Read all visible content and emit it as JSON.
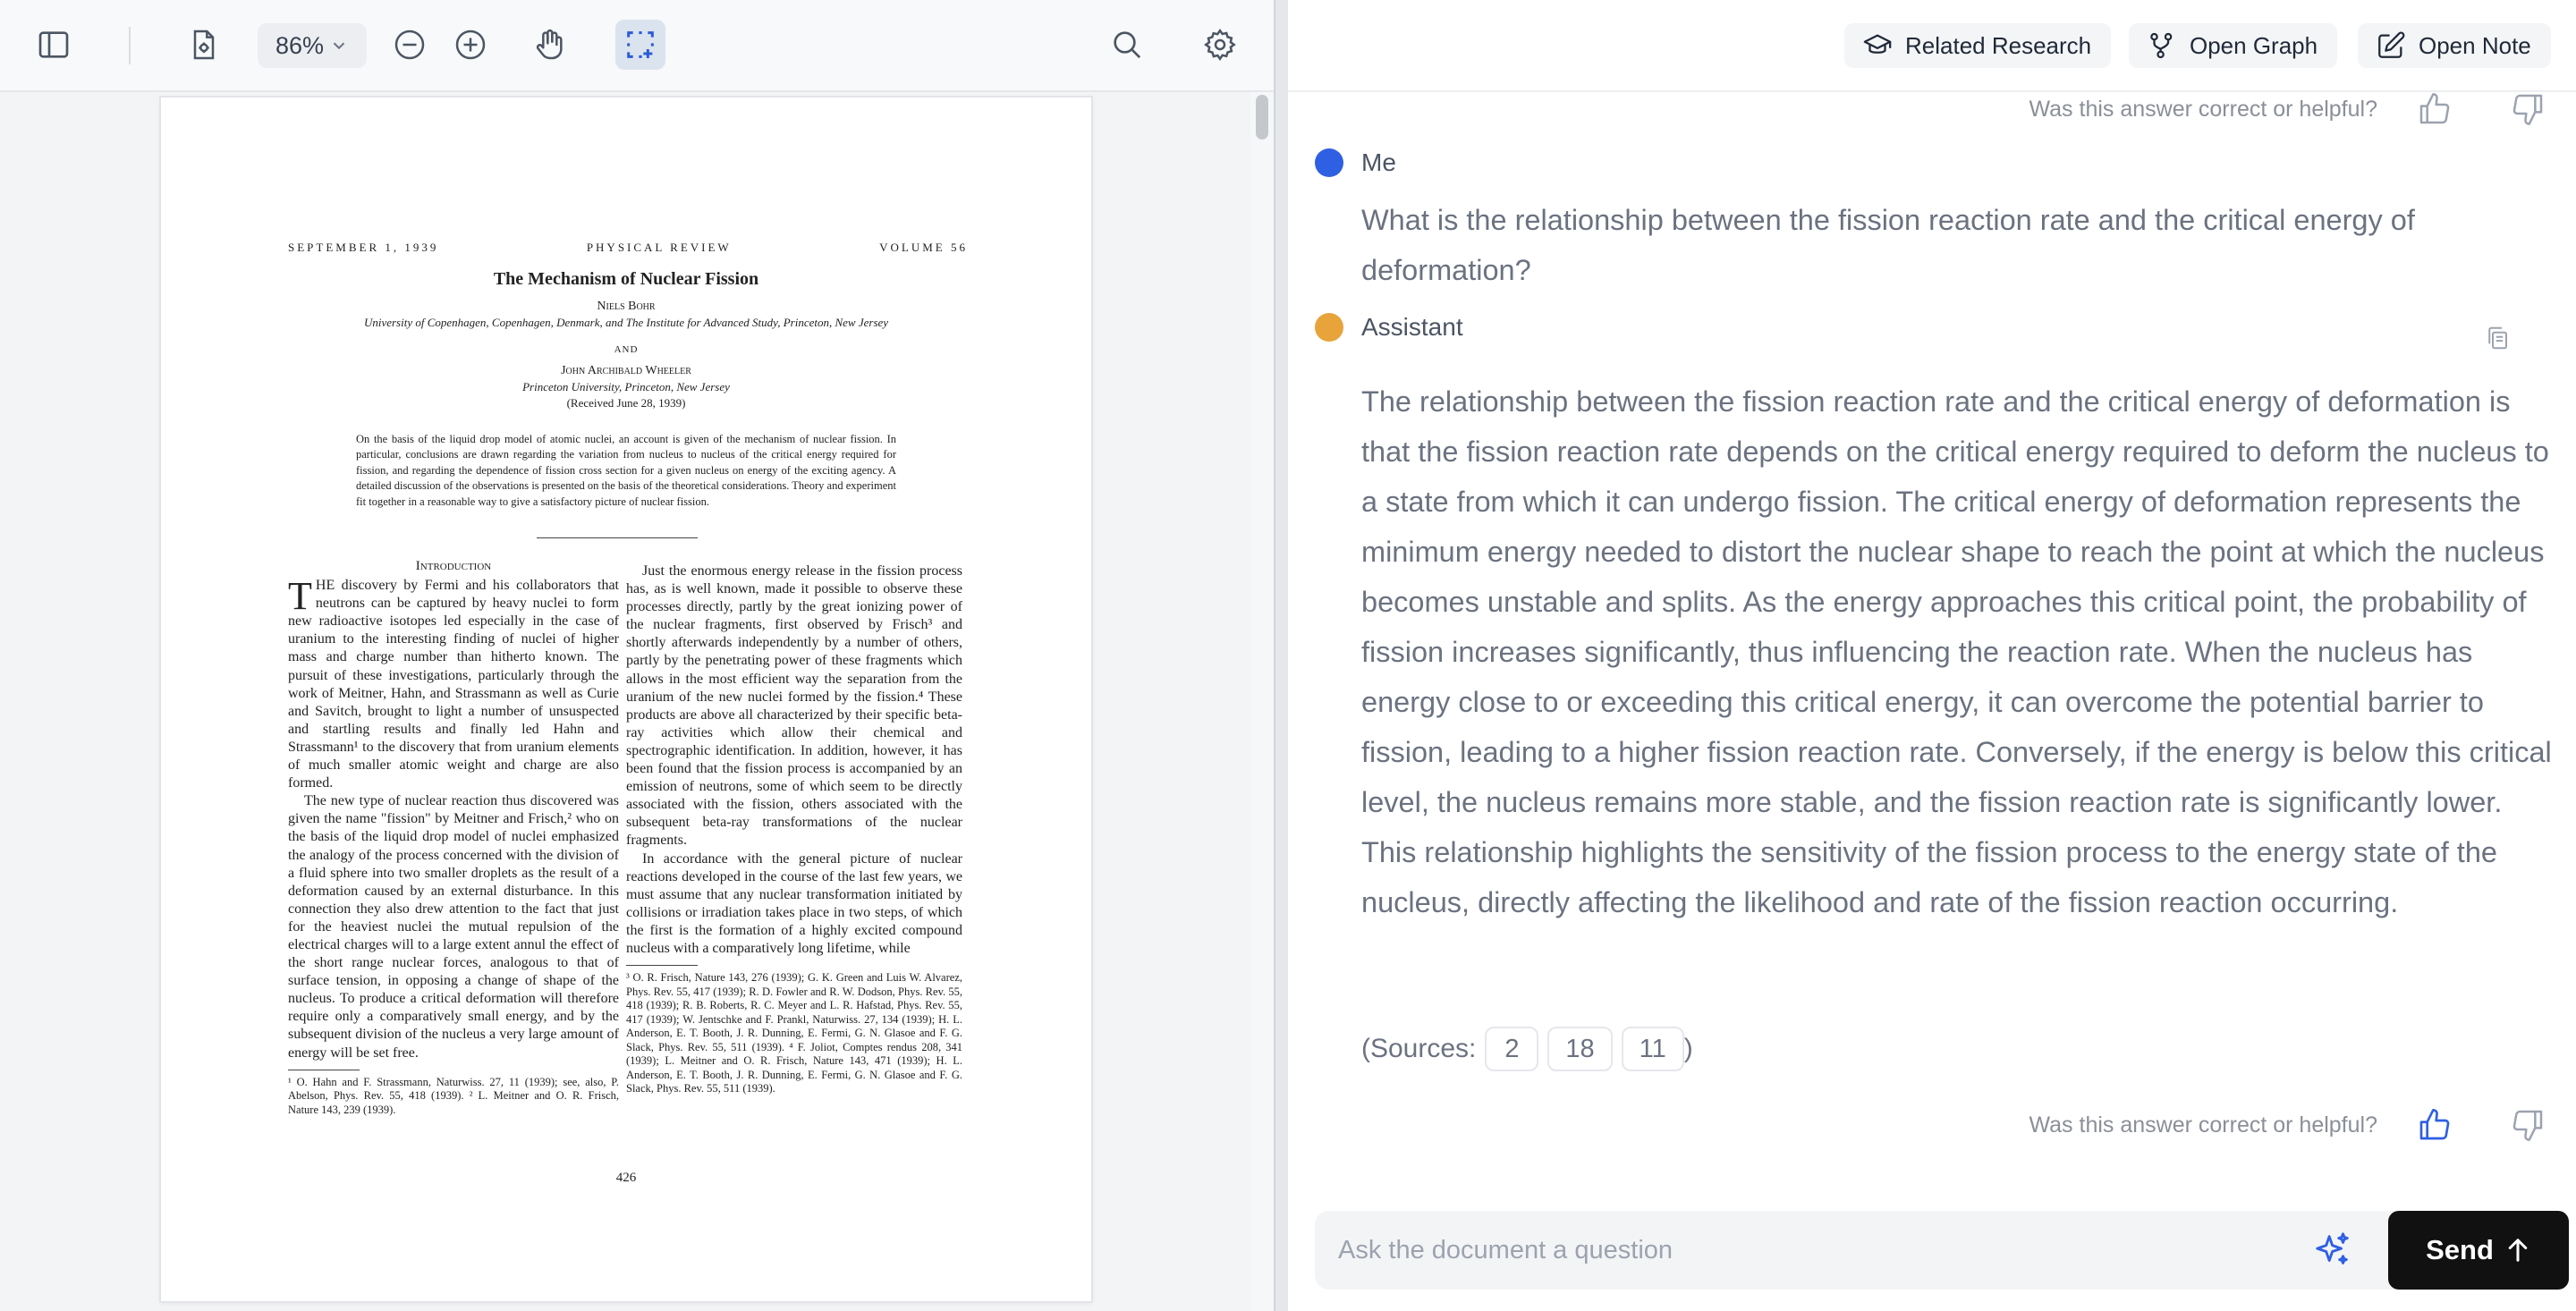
{
  "viewer": {
    "zoom": "86%",
    "pdf": {
      "running_head": {
        "date": "SEPTEMBER 1, 1939",
        "journal": "PHYSICAL REVIEW",
        "volume": "VOLUME 56"
      },
      "title": "The Mechanism of Nuclear Fission",
      "author1": "Niels Bohr",
      "affil1": "University of Copenhagen, Copenhagen, Denmark, and The Institute for Advanced Study, Princeton, New Jersey",
      "and": "AND",
      "author2": "John Archibald Wheeler",
      "affil2": "Princeton University, Princeton, New Jersey",
      "received": "(Received June 28, 1939)",
      "abstract": "On the basis of the liquid drop model of atomic nuclei, an account is given of the mechanism of nuclear fission. In particular, conclusions are drawn regarding the variation from nucleus to nucleus of the critical energy required for fission, and regarding the dependence of fission cross section for a given nucleus on energy of the exciting agency. A detailed discussion of the observations is presented on the basis of the theoretical considerations. Theory and experiment fit together in a reasonable way to give a satisfactory picture of nuclear fission.",
      "intro_heading": "Introduction",
      "dropcap": "T",
      "col1_p1": "HE discovery by Fermi and his collaborators that neutrons can be captured by heavy nuclei to form new radioactive isotopes led especially in the case of uranium to the interesting finding of nuclei of higher mass and charge number than hitherto known. The pursuit of these investigations, particularly through the work of Meitner, Hahn, and Strassmann as well as Curie and Savitch, brought to light a number of unsuspected and startling results and finally led Hahn and Strassmann¹ to the discovery that from uranium elements of much smaller atomic weight and charge are also formed.",
      "col1_p2": "The new type of nuclear reaction thus discovered was given the name \"fission\" by Meitner and Frisch,² who on the basis of the liquid drop model of nuclei emphasized the analogy of the process concerned with the division of a fluid sphere into two smaller droplets as the result of a deformation caused by an external disturbance. In this connection they also drew attention to the fact that just for the heaviest nuclei the mutual repulsion of the electrical charges will to a large extent annul the effect of the short range nuclear forces, analogous to that of surface tension, in opposing a change of shape of the nucleus. To produce a critical deformation will therefore require only a comparatively small energy, and by the subsequent division of the nucleus a very large amount of energy will be set free.",
      "col1_fn": "¹ O. Hahn and F. Strassmann, Naturwiss. 27, 11 (1939); see, also, P. Abelson, Phys. Rev. 55, 418 (1939). ² L. Meitner and O. R. Frisch, Nature 143, 239 (1939).",
      "col2_p1": "Just the enormous energy release in the fission process has, as is well known, made it possible to observe these processes directly, partly by the great ionizing power of the nuclear fragments, first observed by Frisch³ and shortly afterwards independently by a number of others, partly by the penetrating power of these fragments which allows in the most efficient way the separation from the uranium of the new nuclei formed by the fission.⁴ These products are above all characterized by their specific beta-ray activities which allow their chemical and spectrographic identification. In addition, however, it has been found that the fission process is accompanied by an emission of neutrons, some of which seem to be directly associated with the fission, others associated with the subsequent beta-ray transformations of the nuclear fragments.",
      "col2_p2": "In accordance with the general picture of nuclear reactions developed in the course of the last few years, we must assume that any nuclear transformation initiated by collisions or irradiation takes place in two steps, of which the first is the formation of a highly excited compound nucleus with a comparatively long lifetime, while",
      "col2_fn": "³ O. R. Frisch, Nature 143, 276 (1939); G. K. Green and Luis W. Alvarez, Phys. Rev. 55, 417 (1939); R. D. Fowler and R. W. Dodson, Phys. Rev. 55, 418 (1939); R. B. Roberts, R. C. Meyer and L. R. Hafstad, Phys. Rev. 55, 417 (1939); W. Jentschke and F. Prankl, Naturwiss. 27, 134 (1939); H. L. Anderson, E. T. Booth, J. R. Dunning, E. Fermi, G. N. Glasoe and F. G. Slack, Phys. Rev. 55, 511 (1939). ⁴ F. Joliot, Comptes rendus 208, 341 (1939); L. Meitner and O. R. Frisch, Nature 143, 471 (1939); H. L. Anderson, E. T. Booth, J. R. Dunning, E. Fermi, G. N. Glasoe and F. G. Slack, Phys. Rev. 55, 511 (1939).",
      "page_number": "426"
    }
  },
  "chat": {
    "toolbar": {
      "related_research": "Related Research",
      "open_graph": "Open Graph",
      "open_note": "Open Note"
    },
    "feedback_prompt": "Was this answer correct or helpful?",
    "user_label": "Me",
    "user_message": "What is the relationship between the fission reaction rate and the critical energy of deformation?",
    "assistant_label": "Assistant",
    "assistant_message": "The relationship between the fission reaction rate and the critical energy of deformation is that the fission reaction rate depends on the critical energy required to deform the nucleus to a state from which it can undergo fission. The critical energy of deformation represents the minimum energy needed to distort the nuclear shape to reach the point at which the nucleus becomes unstable and splits. As the energy approaches this critical point, the probability of fission increases significantly, thus influencing the reaction rate. When the nucleus has energy close to or exceeding this critical energy, it can overcome the potential barrier to fission, leading to a higher fission reaction rate. Conversely, if the energy is below this critical level, the nucleus remains more stable, and the fission reaction rate is significantly lower. This relationship highlights the sensitivity of the fission process to the energy state of the nucleus, directly affecting the likelihood and rate of the fission reaction occurring.",
    "sources_prefix": "(Sources:",
    "sources_suffix": ")",
    "sources": [
      "2",
      "18",
      "11"
    ],
    "input_placeholder": "Ask the document a question",
    "send_label": "Send"
  },
  "colors": {
    "user_dot": "#2f5fe3",
    "assistant_dot": "#e8a33a",
    "active_tool_bg": "#dbe3ef",
    "send_bg": "#111111"
  }
}
